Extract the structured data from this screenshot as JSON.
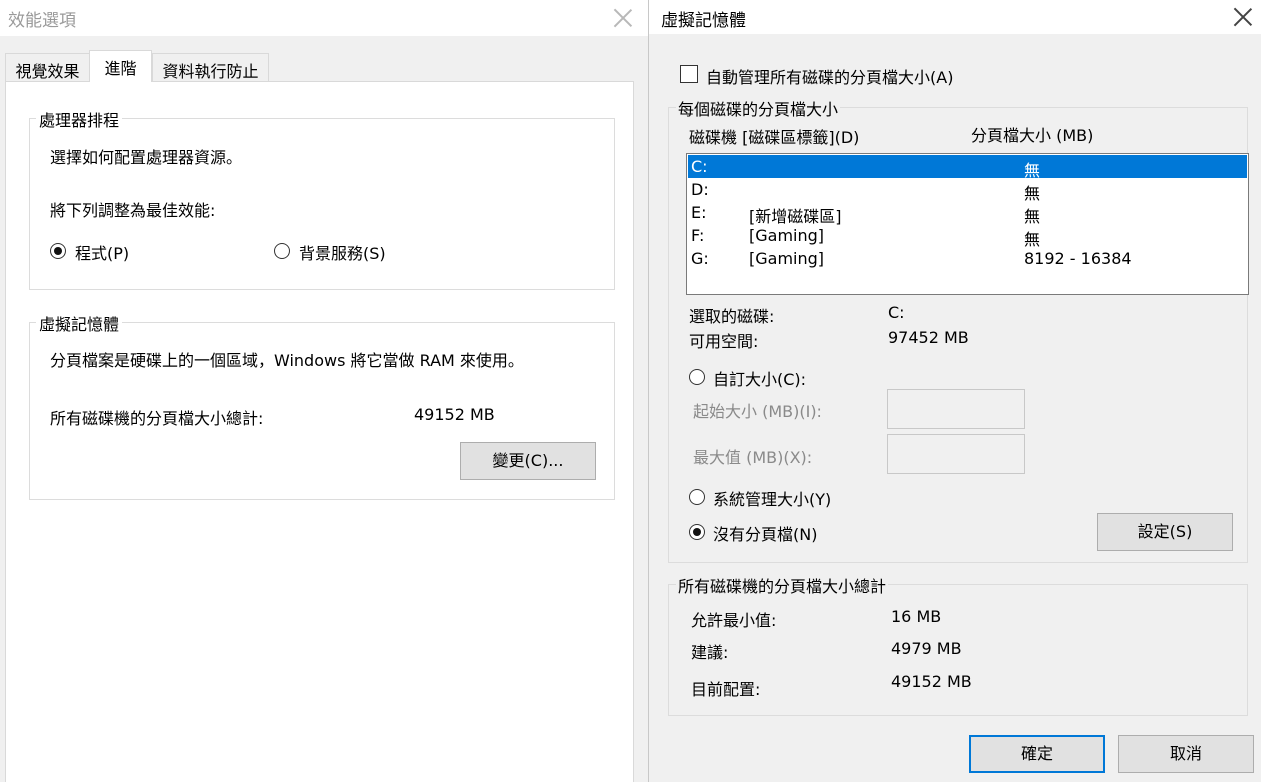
{
  "left": {
    "title": "效能選項",
    "tabs": [
      "視覺效果",
      "進階",
      "資料執行防止"
    ],
    "processor": {
      "legend": "處理器排程",
      "desc": "選擇如何配置處理器資源。",
      "adjust": "將下列調整為最佳效能:",
      "radio_programs": "程式(P)",
      "radio_services": "背景服務(S)"
    },
    "vm": {
      "legend": "虛擬記憶體",
      "desc": "分頁檔案是硬碟上的一個區域，Windows 將它當做 RAM 來使用。",
      "total_label": "所有磁碟機的分頁檔大小總計:",
      "total_value": "49152 MB",
      "change_button": "變更(C)..."
    }
  },
  "right": {
    "title": "虛擬記憶體",
    "auto_manage": "自動管理所有磁碟的分頁檔大小(A)",
    "per_drive": {
      "legend": "每個磁碟的分頁檔大小",
      "col_drive": "磁碟機 [磁碟區標籤](D)",
      "col_size": "分頁檔大小 (MB)",
      "rows": [
        {
          "drive": "C:",
          "label": "",
          "size": "無"
        },
        {
          "drive": "D:",
          "label": "",
          "size": "無"
        },
        {
          "drive": "E:",
          "label": "[新增磁碟區]",
          "size": "無"
        },
        {
          "drive": "F:",
          "label": "[Gaming]",
          "size": "無"
        },
        {
          "drive": "G:",
          "label": "[Gaming]",
          "size": "8192 - 16384"
        }
      ],
      "selected_label": "選取的磁碟:",
      "selected_value": "C:",
      "free_label": "可用空間:",
      "free_value": "97452 MB",
      "custom_size": "自訂大小(C):",
      "initial_size": "起始大小 (MB)(I):",
      "max_size": "最大值 (MB)(X):",
      "system_managed": "系統管理大小(Y)",
      "no_paging": "沒有分頁檔(N)",
      "set_button": "設定(S)"
    },
    "totals": {
      "legend": "所有磁碟機的分頁檔大小總計",
      "min_label": "允許最小值:",
      "min_value": "16 MB",
      "rec_label": "建議:",
      "rec_value": "4979 MB",
      "cur_label": "目前配置:",
      "cur_value": "49152 MB"
    },
    "ok_button": "確定",
    "cancel_button": "取消"
  }
}
